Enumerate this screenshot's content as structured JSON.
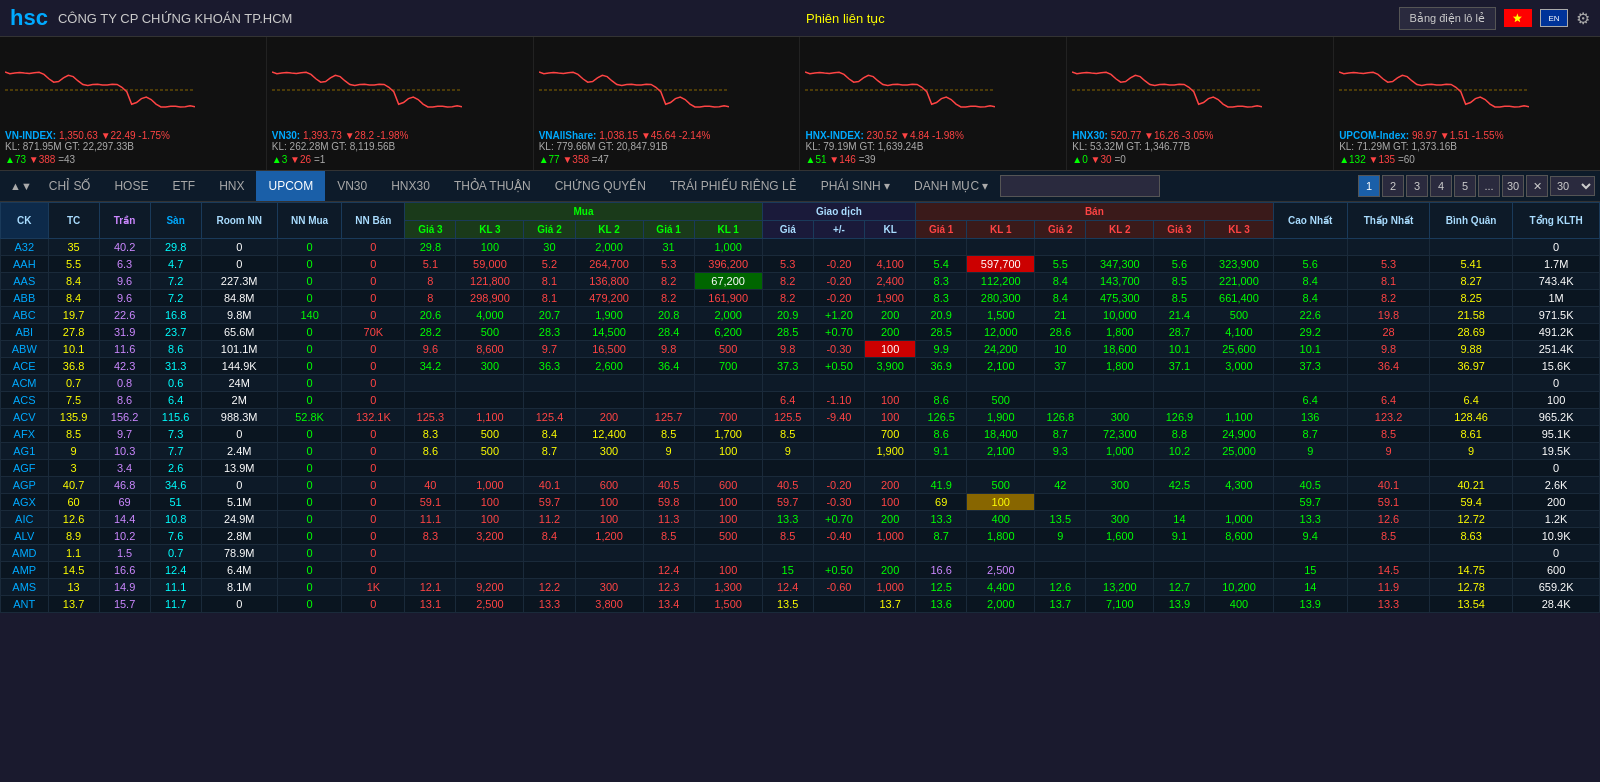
{
  "header": {
    "logo": "hsc",
    "company": "CÔNG TY CP CHỨNG KHOÁN TP.HCM",
    "session": "Phiên liên tục",
    "bang_dien": "Bảng điện lô lẻ",
    "settings_icon": "⚙"
  },
  "indexes": [
    {
      "name": "VN-INDEX",
      "value": "1,350.63",
      "change": "-22.49",
      "pct": "-1.75%",
      "kl": "KL: 871.95M",
      "gt": "GT: 22,297.33B",
      "up": "73",
      "down": "388",
      "neu": "43",
      "color": "red",
      "range": [
        1255,
        1291
      ]
    },
    {
      "name": "VN30",
      "value": "1,393.73",
      "change": "-28.2",
      "pct": "-1.98%",
      "kl": "KL: 262.28M",
      "gt": "GT: 8,119.56B",
      "up": "3",
      "down": "26",
      "neu": "1",
      "color": "red",
      "range": [
        1289,
        1328
      ]
    },
    {
      "name": "VNAllShare",
      "value": "1,038.15",
      "change": "-45.64",
      "pct": "-2.14%",
      "kl": "KL: 779.66M",
      "gt": "GT: 20,847.91B",
      "up": "77",
      "down": "358",
      "neu": "47",
      "color": "red",
      "range": [
        1304,
        1356
      ]
    },
    {
      "name": "HNX-INDEX",
      "value": "230.52",
      "change": "-4.84",
      "pct": "-1.98%",
      "kl": "KL: 79.19M",
      "gt": "GT: 1,639.24B",
      "up": "51",
      "down": "146",
      "neu": "39",
      "color": "red",
      "range": [
        238,
        247
      ]
    },
    {
      "name": "HNX30",
      "value": "520.77",
      "change": "-16.26",
      "pct": "-3.05%",
      "kl": "KL: 53.32M",
      "gt": "GT: 1,346.77B",
      "up": "0",
      "down": "30",
      "neu": "0",
      "color": "red",
      "range": [
        517,
        544
      ]
    },
    {
      "name": "UPCOM-Index",
      "value": "98.97",
      "change": "-1.51",
      "pct": "-1.55%",
      "kl": "KL: 71.29M",
      "gt": "GT: 1,373.16B",
      "up": "132",
      "down": "135",
      "neu": "60",
      "color": "red",
      "range": [
        98,
        102
      ]
    }
  ],
  "nav": {
    "tabs": [
      "CHỈ SỐ",
      "HOSE",
      "ETF",
      "HNX",
      "UPCOM",
      "VN30",
      "HNX30",
      "THỎA THUẬN",
      "CHỨNG QUYỀN",
      "TRÁI PHIẾU RIÊNG LẺ",
      "PHÁI SINH",
      "DANH MỤC"
    ],
    "active": "UPCOM",
    "pages": [
      "1",
      "2",
      "3",
      "4",
      "5",
      "...",
      "30"
    ],
    "per_page": "30",
    "search_placeholder": ""
  },
  "table": {
    "headers": {
      "ck": "CK",
      "tc": "TC",
      "tran": "Trần",
      "san": "Sàn",
      "room_nn": "Room NN",
      "nn_mua": "NN Mua",
      "nn_ban": "NN Bán",
      "mua": "Mua",
      "mua_cols": [
        "Giá 3",
        "KL 3",
        "Giá 2",
        "KL 2",
        "Giá 1",
        "KL 1"
      ],
      "giao_dich": "Giao dịch",
      "gd_cols": [
        "Giá",
        "+/-",
        "KL"
      ],
      "ban": "Bán",
      "ban_cols": [
        "Giá 1",
        "KL 1",
        "Giá 2",
        "KL 2",
        "Giá 3",
        "KL 3"
      ],
      "cao_nhat": "Cao Nhất",
      "thap_nhat": "Thấp Nhất",
      "binh_quan": "Bình Quân",
      "tong_klth": "Tổng KLTH"
    },
    "rows": [
      {
        "ck": "A32",
        "tc": "35",
        "tran": "40.2",
        "san": "29.8",
        "room_nn": "0",
        "nn_mua": "0",
        "nn_ban": "0",
        "g3": "29.8",
        "kl3": "100",
        "g2": "30",
        "kl2": "2,000",
        "g1": "31",
        "kl1": "1,000",
        "gia": "",
        "pm": "",
        "kl": "",
        "bg1": "",
        "bkl1": "",
        "bg2": "",
        "bkl2": "",
        "bg3": "",
        "bkl3": "",
        "cao": "",
        "thap": "",
        "bq": "",
        "tklth": "0",
        "gia_color": "yellow",
        "g1c": "green",
        "g2c": "green",
        "g3c": "green"
      },
      {
        "ck": "AAH",
        "tc": "5.5",
        "tran": "6.3",
        "san": "4.7",
        "room_nn": "0",
        "nn_mua": "0",
        "nn_ban": "0",
        "g3": "5.1",
        "kl3": "59,000",
        "g2": "5.2",
        "kl2": "264,700",
        "g1": "5.3",
        "kl1": "396,200",
        "gia": "5.3",
        "pm": "-0.20",
        "kl": "4,100",
        "bg1": "5.4",
        "bkl1": "597,700",
        "bg2": "5.5",
        "bkl2": "347,300",
        "bg3": "5.6",
        "bkl3": "323,900",
        "cao": "5.6",
        "thap": "5.3",
        "bq": "5.41",
        "tklth": "1.7M",
        "gia_color": "red",
        "g1c": "red",
        "bkl1_bg": "red",
        "bg1c": "green"
      },
      {
        "ck": "AAS",
        "tc": "8.4",
        "tran": "9.6",
        "san": "7.2",
        "room_nn": "227.3M",
        "nn_mua": "0",
        "nn_ban": "0",
        "g3": "8",
        "kl3": "121,800",
        "g2": "8.1",
        "kl2": "136,800",
        "g1": "8.2",
        "kl1": "67,200",
        "gia": "8.2",
        "pm": "-0.20",
        "kl": "2,400",
        "bg1": "8.3",
        "bkl1": "112,200",
        "bg2": "8.4",
        "bkl2": "143,700",
        "bg3": "8.5",
        "bkl3": "221,000",
        "cao": "8.4",
        "thap": "8.1",
        "bq": "8.27",
        "tklth": "743.4K",
        "gia_color": "red",
        "g1c": "red",
        "kl1_bg": "green",
        "bg1c": "green"
      },
      {
        "ck": "ABB",
        "tc": "8.4",
        "tran": "9.6",
        "san": "7.2",
        "room_nn": "84.8M",
        "nn_mua": "0",
        "nn_ban": "0",
        "g3": "8",
        "kl3": "298,900",
        "g2": "8.1",
        "kl2": "479,200",
        "g1": "8.2",
        "kl1": "161,900",
        "gia": "8.2",
        "pm": "-0.20",
        "kl": "1,900",
        "bg1": "8.3",
        "bkl1": "280,300",
        "bg2": "8.4",
        "bkl2": "475,300",
        "bg3": "8.5",
        "bkl3": "661,400",
        "cao": "8.4",
        "thap": "8.2",
        "bq": "8.25",
        "tklth": "1M",
        "gia_color": "red",
        "g1c": "red",
        "bg1c": "green"
      },
      {
        "ck": "ABC",
        "tc": "19.7",
        "tran": "22.6",
        "san": "16.8",
        "room_nn": "9.8M",
        "nn_mua": "140",
        "nn_ban": "0",
        "g3": "20.6",
        "kl3": "4,000",
        "g2": "20.7",
        "kl2": "1,900",
        "g1": "20.8",
        "kl1": "2,000",
        "gia": "20.9",
        "pm": "+1.20",
        "kl": "200",
        "bg1": "20.9",
        "bkl1": "1,500",
        "bg2": "21",
        "bkl2": "10,000",
        "bg3": "21.4",
        "bkl3": "500",
        "cao": "22.6",
        "thap": "19.8",
        "bq": "21.58",
        "tklth": "971.5K",
        "gia_color": "green",
        "g1c": "green",
        "bg1c": "green"
      },
      {
        "ck": "ABI",
        "tc": "27.8",
        "tran": "31.9",
        "san": "23.7",
        "room_nn": "65.6M",
        "nn_mua": "0",
        "nn_ban": "70K",
        "g3": "28.2",
        "kl3": "500",
        "g2": "28.3",
        "kl2": "14,500",
        "g1": "28.4",
        "kl1": "6,200",
        "gia": "28.5",
        "pm": "+0.70",
        "kl": "200",
        "bg1": "28.5",
        "bkl1": "12,000",
        "bg2": "28.6",
        "bkl2": "1,800",
        "bg3": "28.7",
        "bkl3": "4,100",
        "cao": "29.2",
        "thap": "28",
        "bq": "28.69",
        "tklth": "491.2K",
        "gia_color": "green",
        "g1c": "green",
        "bg1c": "green"
      },
      {
        "ck": "ABW",
        "tc": "10.1",
        "tran": "11.6",
        "san": "8.6",
        "room_nn": "101.1M",
        "nn_mua": "0",
        "nn_ban": "0",
        "g3": "9.6",
        "kl3": "8,600",
        "g2": "9.7",
        "kl2": "16,500",
        "g1": "9.8",
        "kl1": "500",
        "gia": "9.8",
        "pm": "-0.30",
        "kl": "100",
        "bg1": "9.9",
        "bkl1": "24,200",
        "bg2": "10",
        "bkl2": "18,600",
        "bg3": "10.1",
        "bkl3": "25,600",
        "cao": "10.1",
        "thap": "9.8",
        "bq": "9.88",
        "tklth": "251.4K",
        "gia_color": "red",
        "g1c": "red",
        "kl_bg": "red",
        "bg1c": "green"
      },
      {
        "ck": "ACE",
        "tc": "36.8",
        "tran": "42.3",
        "san": "31.3",
        "room_nn": "144.9K",
        "nn_mua": "0",
        "nn_ban": "0",
        "g3": "34.2",
        "kl3": "300",
        "g2": "36.3",
        "kl2": "2,600",
        "g1": "36.4",
        "kl1": "700",
        "gia": "37.3",
        "pm": "+0.50",
        "kl": "3,900",
        "bg1": "36.9",
        "bkl1": "2,100",
        "bg2": "37",
        "bkl2": "1,800",
        "bg3": "37.1",
        "bkl3": "3,000",
        "cao": "37.3",
        "thap": "36.4",
        "bq": "36.97",
        "tklth": "15.6K",
        "gia_color": "green",
        "g1c": "green",
        "bg1c": "green"
      },
      {
        "ck": "ACM",
        "tc": "0.7",
        "tran": "0.8",
        "san": "0.6",
        "room_nn": "24M",
        "nn_mua": "0",
        "nn_ban": "0",
        "g3": "",
        "kl3": "",
        "g2": "",
        "kl2": "",
        "g1": "",
        "kl1": "",
        "gia": "",
        "pm": "",
        "kl": "",
        "bg1": "",
        "bkl1": "",
        "bg2": "",
        "bkl2": "",
        "bg3": "",
        "bkl3": "",
        "cao": "",
        "thap": "",
        "bq": "",
        "tklth": "0",
        "gia_color": "",
        "g1c": "",
        "bg1c": ""
      },
      {
        "ck": "ACS",
        "tc": "7.5",
        "tran": "8.6",
        "san": "6.4",
        "room_nn": "2M",
        "nn_mua": "0",
        "nn_ban": "0",
        "g3": "",
        "kl3": "",
        "g2": "",
        "kl2": "",
        "g1": "",
        "kl1": "",
        "gia": "6.4",
        "pm": "-1.10",
        "kl": "100",
        "bg1": "8.6",
        "bkl1": "500",
        "bg2": "",
        "bkl2": "",
        "bg3": "",
        "bkl3": "",
        "cao": "6.4",
        "thap": "6.4",
        "bq": "6.4",
        "tklth": "100",
        "gia_color": "red",
        "g1c": "",
        "bg1c": "green"
      },
      {
        "ck": "ACV",
        "tc": "135.9",
        "tran": "156.2",
        "san": "115.6",
        "room_nn": "988.3M",
        "nn_mua": "52.8K",
        "nn_ban": "132.1K",
        "g3": "125.3",
        "kl3": "1,100",
        "g2": "125.4",
        "kl2": "200",
        "g1": "125.7",
        "kl1": "700",
        "gia": "125.5",
        "pm": "-9.40",
        "kl": "100",
        "bg1": "126.5",
        "bkl1": "1,900",
        "bg2": "126.8",
        "bkl2": "300",
        "bg3": "126.9",
        "bkl3": "1,100",
        "cao": "136",
        "thap": "123.2",
        "bq": "128.46",
        "tklth": "965.2K",
        "gia_color": "red",
        "g1c": "red",
        "bg1c": "green"
      },
      {
        "ck": "AFX",
        "tc": "8.5",
        "tran": "9.7",
        "san": "7.3",
        "room_nn": "0",
        "nn_mua": "0",
        "nn_ban": "0",
        "g3": "8.3",
        "kl3": "500",
        "g2": "8.4",
        "kl2": "12,400",
        "g1": "8.5",
        "kl1": "1,700",
        "gia": "8.5",
        "pm": "",
        "kl": "700",
        "bg1": "8.6",
        "bkl1": "18,400",
        "bg2": "8.7",
        "bkl2": "72,300",
        "bg3": "8.8",
        "bkl3": "24,900",
        "cao": "8.7",
        "thap": "8.5",
        "bq": "8.61",
        "tklth": "95.1K",
        "gia_color": "yellow",
        "g1c": "yellow",
        "bg1c": "green"
      },
      {
        "ck": "AG1",
        "tc": "9",
        "tran": "10.3",
        "san": "7.7",
        "room_nn": "2.4M",
        "nn_mua": "0",
        "nn_ban": "0",
        "g3": "8.6",
        "kl3": "500",
        "g2": "8.7",
        "kl2": "300",
        "g1": "9",
        "kl1": "100",
        "gia": "9",
        "pm": "",
        "kl": "1,900",
        "bg1": "9.1",
        "bkl1": "2,100",
        "bg2": "9.3",
        "bkl2": "1,000",
        "bg3": "10.2",
        "bkl3": "25,000",
        "cao": "9",
        "thap": "9",
        "bq": "9",
        "tklth": "19.5K",
        "gia_color": "yellow",
        "g1c": "yellow",
        "bg1c": "green"
      },
      {
        "ck": "AGF",
        "tc": "3",
        "tran": "3.4",
        "san": "2.6",
        "room_nn": "13.9M",
        "nn_mua": "0",
        "nn_ban": "0",
        "g3": "",
        "kl3": "",
        "g2": "",
        "kl2": "",
        "g1": "",
        "kl1": "",
        "gia": "",
        "pm": "",
        "kl": "",
        "bg1": "",
        "bkl1": "",
        "bg2": "",
        "bkl2": "",
        "bg3": "",
        "bkl3": "",
        "cao": "",
        "thap": "",
        "bq": "",
        "tklth": "0",
        "gia_color": "",
        "g1c": "",
        "bg1c": ""
      },
      {
        "ck": "AGP",
        "tc": "40.7",
        "tran": "46.8",
        "san": "34.6",
        "room_nn": "0",
        "nn_mua": "0",
        "nn_ban": "0",
        "g3": "40",
        "kl3": "1,000",
        "g2": "40.1",
        "kl2": "600",
        "g1": "40.5",
        "kl1": "600",
        "gia": "40.5",
        "pm": "-0.20",
        "kl": "200",
        "bg1": "41.9",
        "bkl1": "500",
        "bg2": "42",
        "bkl2": "300",
        "bg3": "42.5",
        "bkl3": "4,300",
        "cao": "40.5",
        "thap": "40.1",
        "bq": "40.21",
        "tklth": "2.6K",
        "gia_color": "red",
        "g1c": "red",
        "bg1c": "green"
      },
      {
        "ck": "AGX",
        "tc": "60",
        "tran": "69",
        "san": "51",
        "room_nn": "5.1M",
        "nn_mua": "0",
        "nn_ban": "0",
        "g3": "59.1",
        "kl3": "100",
        "g2": "59.7",
        "kl2": "100",
        "g1": "59.8",
        "kl1": "100",
        "gia": "59.7",
        "pm": "-0.30",
        "kl": "100",
        "bg1": "69",
        "bkl1": "100",
        "bg2": "",
        "bkl2": "",
        "bg3": "",
        "bkl3": "",
        "cao": "59.7",
        "thap": "59.1",
        "bq": "59.4",
        "tklth": "200",
        "gia_color": "red",
        "g1c": "red",
        "bg1c": "yellow"
      },
      {
        "ck": "AIC",
        "tc": "12.6",
        "tran": "14.4",
        "san": "10.8",
        "room_nn": "24.9M",
        "nn_mua": "0",
        "nn_ban": "0",
        "g3": "11.1",
        "kl3": "100",
        "g2": "11.2",
        "kl2": "100",
        "g1": "11.3",
        "kl1": "100",
        "gia": "13.3",
        "pm": "+0.70",
        "kl": "200",
        "bg1": "13.3",
        "bkl1": "400",
        "bg2": "13.5",
        "bkl2": "300",
        "bg3": "14",
        "bkl3": "1,000",
        "cao": "13.3",
        "thap": "12.6",
        "bq": "12.72",
        "tklth": "1.2K",
        "gia_color": "green",
        "g1c": "red",
        "bg1c": "green"
      },
      {
        "ck": "ALV",
        "tc": "8.9",
        "tran": "10.2",
        "san": "7.6",
        "room_nn": "2.8M",
        "nn_mua": "0",
        "nn_ban": "0",
        "g3": "8.3",
        "kl3": "3,200",
        "g2": "8.4",
        "kl2": "1,200",
        "g1": "8.5",
        "kl1": "500",
        "gia": "8.5",
        "pm": "-0.40",
        "kl": "1,000",
        "bg1": "8.7",
        "bkl1": "1,800",
        "bg2": "9",
        "bkl2": "1,600",
        "bg3": "9.1",
        "bkl3": "8,600",
        "cao": "9.4",
        "thap": "8.5",
        "bq": "8.63",
        "tklth": "10.9K",
        "gia_color": "red",
        "g1c": "red",
        "bg1c": "green"
      },
      {
        "ck": "AMD",
        "tc": "1.1",
        "tran": "1.5",
        "san": "0.7",
        "room_nn": "78.9M",
        "nn_mua": "0",
        "nn_ban": "0",
        "g3": "",
        "kl3": "",
        "g2": "",
        "kl2": "",
        "g1": "",
        "kl1": "",
        "gia": "",
        "pm": "",
        "kl": "",
        "bg1": "",
        "bkl1": "",
        "bg2": "",
        "bkl2": "",
        "bg3": "",
        "bkl3": "",
        "cao": "",
        "thap": "",
        "bq": "",
        "tklth": "0",
        "gia_color": "",
        "g1c": "",
        "bg1c": ""
      },
      {
        "ck": "AMP",
        "tc": "14.5",
        "tran": "16.6",
        "san": "12.4",
        "room_nn": "6.4M",
        "nn_mua": "0",
        "nn_ban": "0",
        "g3": "",
        "kl3": "",
        "g2": "",
        "kl2": "",
        "g1": "12.4",
        "kl1": "100",
        "gia": "15",
        "pm": "+0.50",
        "kl": "200",
        "bg1": "16.6",
        "bkl1": "2,500",
        "bg2": "",
        "bkl2": "",
        "bg3": "",
        "bkl3": "",
        "cao": "15",
        "thap": "14.5",
        "bq": "14.75",
        "tklth": "600",
        "gia_color": "green",
        "g1c": "red",
        "bg1c": "purple"
      },
      {
        "ck": "AMS",
        "tc": "13",
        "tran": "14.9",
        "san": "11.1",
        "room_nn": "8.1M",
        "nn_mua": "0",
        "nn_ban": "1K",
        "g3": "12.1",
        "kl3": "9,200",
        "g2": "12.2",
        "kl2": "300",
        "g1": "12.3",
        "kl1": "1,300",
        "gia": "12.4",
        "pm": "-0.60",
        "kl": "1,000",
        "bg1": "12.5",
        "bkl1": "4,400",
        "bg2": "12.6",
        "bkl2": "13,200",
        "bg3": "12.7",
        "bkl3": "10,200",
        "cao": "14",
        "thap": "11.9",
        "bq": "12.78",
        "tklth": "659.2K",
        "gia_color": "red",
        "g1c": "red",
        "bg1c": "green"
      },
      {
        "ck": "ANT",
        "tc": "13.7",
        "tran": "15.7",
        "san": "11.7",
        "room_nn": "0",
        "nn_mua": "0",
        "nn_ban": "0",
        "g3": "13.1",
        "kl3": "2,500",
        "g2": "13.3",
        "kl2": "3,800",
        "g1": "13.4",
        "kl1": "1,500",
        "gia": "13.5",
        "pm": "",
        "kl": "13.7",
        "bg1": "13.6",
        "bkl1": "2,000",
        "bg2": "13.7",
        "bkl2": "7,100",
        "bg3": "13.9",
        "bkl3": "400",
        "cao": "13.9",
        "thap": "13.3",
        "bq": "13.54",
        "tklth": "28.4K",
        "gia_color": "yellow",
        "g1c": "red",
        "bg1c": "green"
      }
    ]
  }
}
